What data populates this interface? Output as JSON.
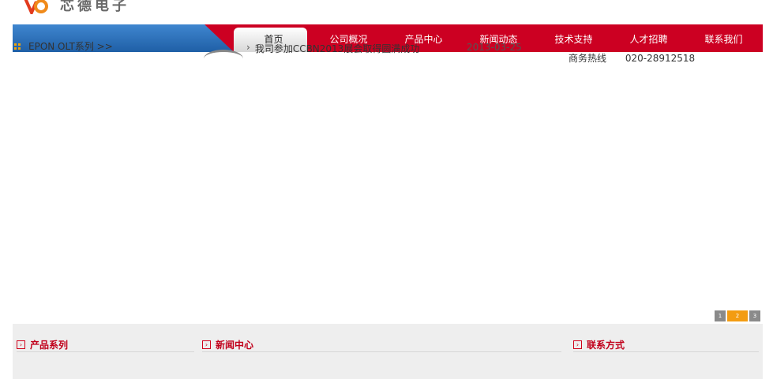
{
  "brand": {
    "name": "芯德电子"
  },
  "nav": {
    "items": [
      {
        "label": "首页",
        "active": true
      },
      {
        "label": "公司概况"
      },
      {
        "label": "产品中心"
      },
      {
        "label": "新闻动态"
      },
      {
        "label": "技术支持"
      },
      {
        "label": "人才招聘"
      },
      {
        "label": "联系我们"
      }
    ]
  },
  "banner": {
    "pages": [
      "1",
      "2",
      "3"
    ],
    "active_page": "2"
  },
  "sections": {
    "products": {
      "title": "产品系列",
      "items": [
        "EPON OLT系列 >>"
      ]
    },
    "news": {
      "title": "新闻中心",
      "items": [
        {
          "title": "我司参加CCBN2013展会取得圆满成功",
          "date": "2013-03-25"
        }
      ]
    },
    "contact": {
      "title": "联系方式",
      "lines": [
        {
          "label": "商务热线",
          "value": "020-28912518"
        }
      ]
    }
  },
  "colors": {
    "nav_red": "#cc0022",
    "nav_blue": "#2a6fb5",
    "accent_orange": "#f39c12",
    "heading_red": "#c1001b"
  }
}
